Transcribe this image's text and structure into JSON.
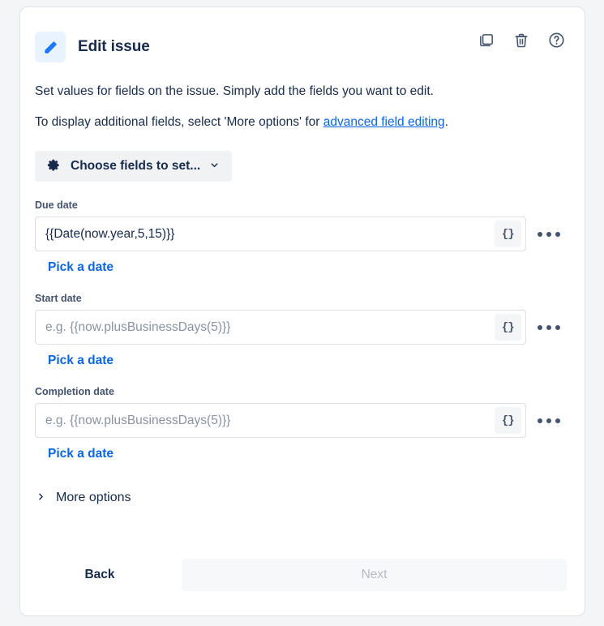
{
  "theme": {
    "page_bg": "#f4f5f7",
    "card_bg": "#ffffff",
    "card_border": "#dfe1e6",
    "text": "#172b4d",
    "label": "#44546f",
    "link": "#0c66e4",
    "accent_icon_bg": "#e9f2ff",
    "accent_icon": "#1d7afc",
    "placeholder": "#8993a4",
    "disabled_btn_bg": "#f7f8f9",
    "disabled_btn_text": "#b3bac5"
  },
  "header": {
    "title": "Edit issue",
    "rule_icon": "pencil-icon",
    "actions": [
      {
        "name": "duplicate-component-button",
        "icon": "copy-icon",
        "tooltip": "Duplicate"
      },
      {
        "name": "delete-component-button",
        "icon": "trash-icon",
        "tooltip": "Delete"
      },
      {
        "name": "help-button",
        "icon": "question-circle-icon",
        "tooltip": "Help"
      }
    ]
  },
  "description": {
    "line1": "Set values for fields on the issue. Simply add the fields you want to edit.",
    "line2_prefix": "To display additional fields, select 'More options' for ",
    "line2_link": "advanced field editing",
    "line2_suffix": "."
  },
  "choose_fields": {
    "label": "Choose fields to set...",
    "gear_icon": "gear-icon",
    "chevron_icon": "chevron-down-icon"
  },
  "fields": [
    {
      "label": "Due date",
      "value": "{{Date(now.year,5,15)}}",
      "placeholder": "e.g. {{now.plusBusinessDays(5)}}",
      "has_value": true,
      "smart_value_label": "{}",
      "pick_date_label": "Pick a date"
    },
    {
      "label": "Start date",
      "value": "",
      "placeholder": "e.g. {{now.plusBusinessDays(5)}}",
      "has_value": false,
      "smart_value_label": "{}",
      "pick_date_label": "Pick a date"
    },
    {
      "label": "Completion date",
      "value": "",
      "placeholder": "e.g. {{now.plusBusinessDays(5)}}",
      "has_value": false,
      "smart_value_label": "{}",
      "pick_date_label": "Pick a date"
    }
  ],
  "more_options": {
    "label": "More options",
    "expanded": false,
    "chevron_icon": "chevron-right-icon"
  },
  "footer": {
    "back_label": "Back",
    "next_label": "Next",
    "next_disabled": true
  }
}
